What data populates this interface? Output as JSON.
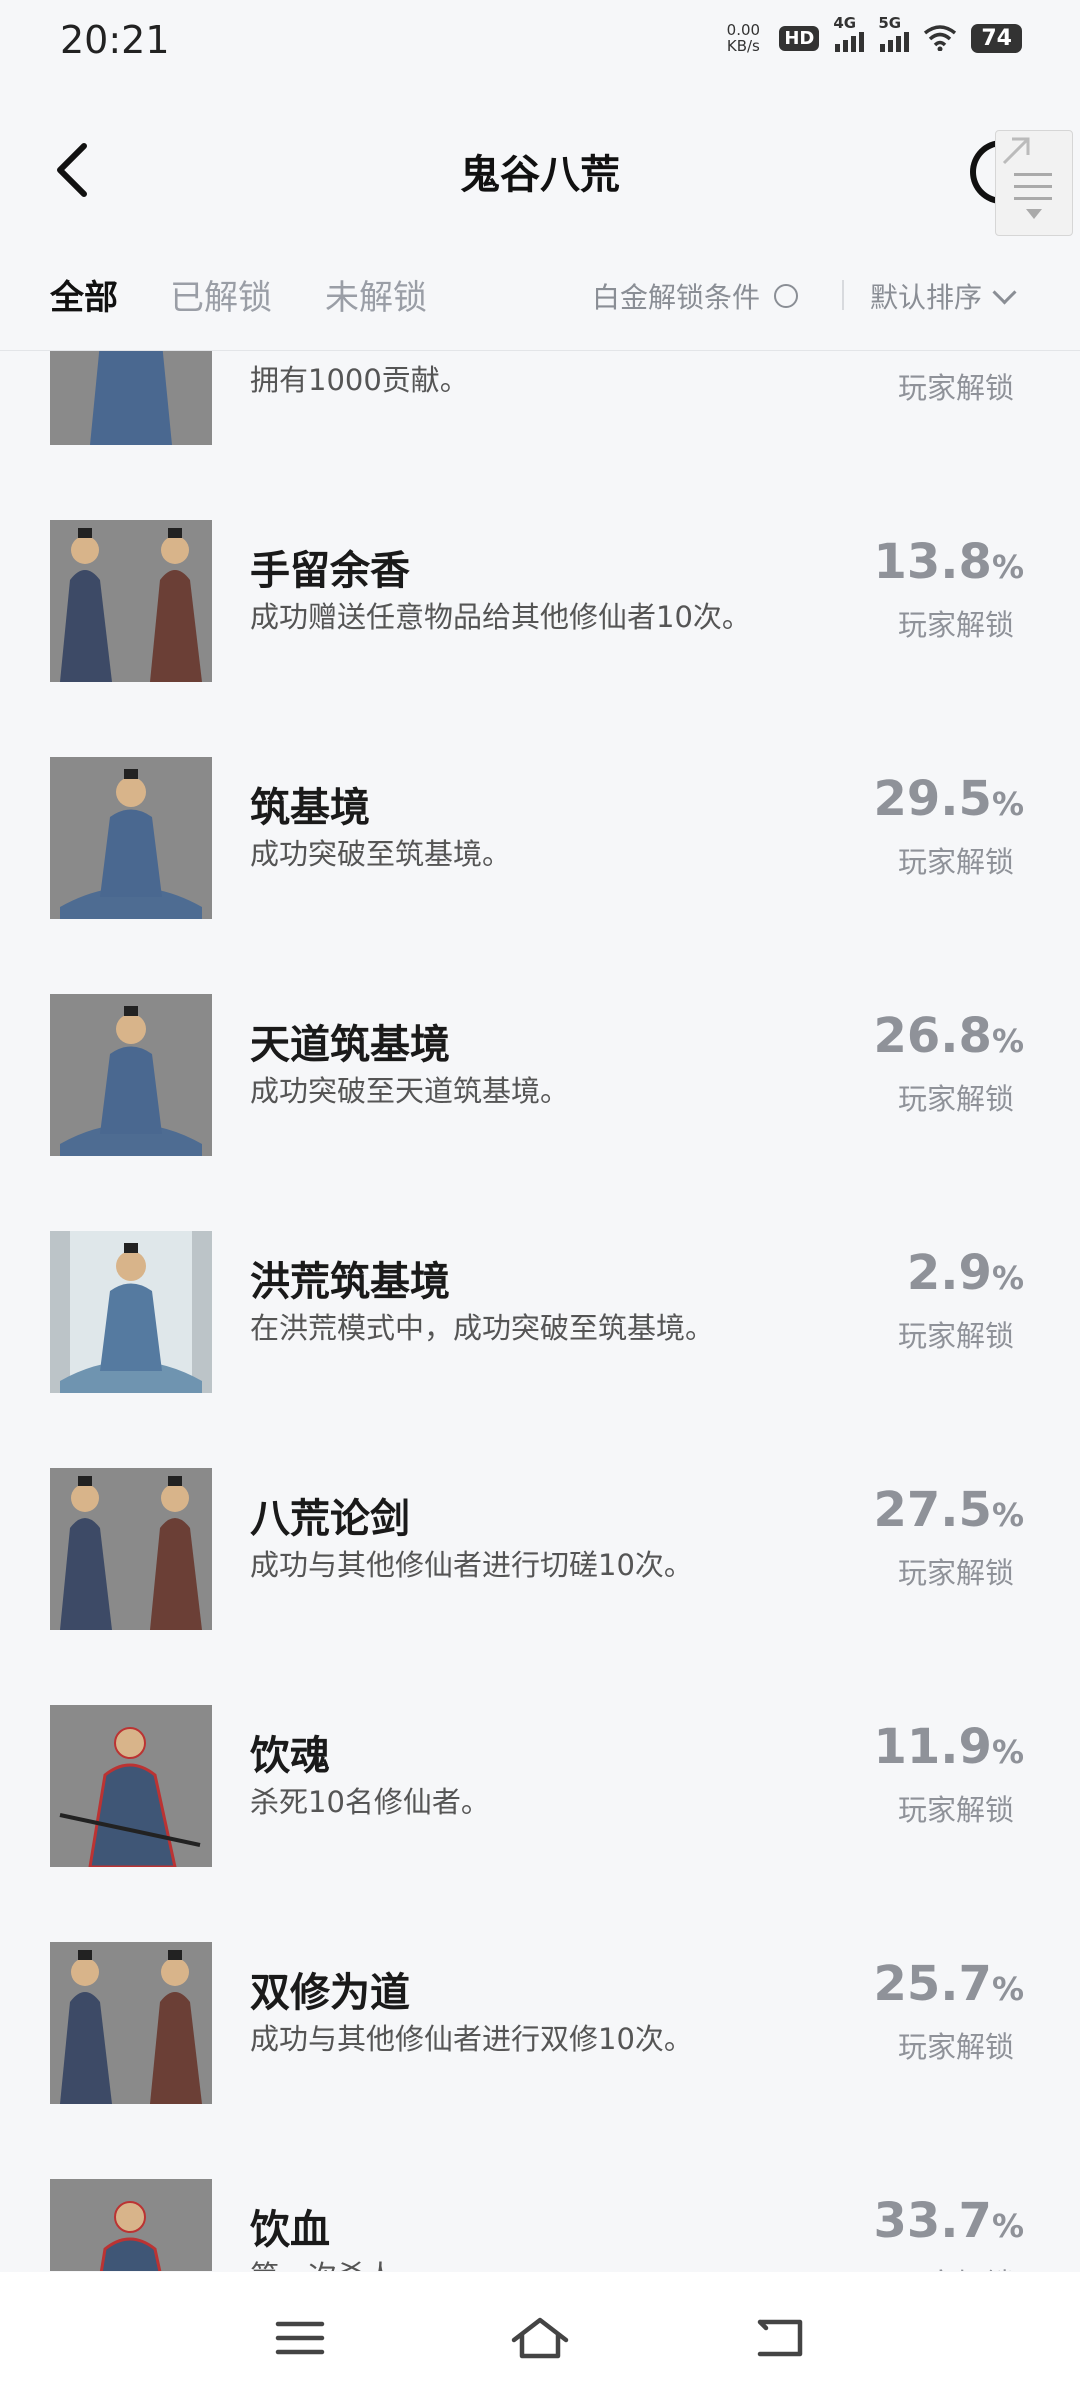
{
  "status": {
    "time": "20:21",
    "net_speed_value": "0.00",
    "net_speed_unit": "KB/s",
    "hd": "HD",
    "sim1": "4G",
    "sim2": "5G",
    "battery": "74"
  },
  "header": {
    "title": "鬼谷八荒"
  },
  "filters": {
    "tabs": [
      "全部",
      "已解锁",
      "未解锁"
    ],
    "condition_label": "白金解锁条件",
    "sort_label": "默认排序"
  },
  "unlock_suffix": "玩家解锁",
  "percent_unit": "%",
  "achievements": [
    {
      "name": "",
      "desc": "拥有1000贡献。",
      "percent": "",
      "icon": "cultivator-standing-icon"
    },
    {
      "name": "手留余香",
      "desc": "成功赠送任意物品给其他修仙者10次。",
      "percent": "13.8",
      "icon": "two-cultivators-bowing-icon"
    },
    {
      "name": "筑基境",
      "desc": "成功突破至筑基境。",
      "percent": "29.5",
      "icon": "meditating-cultivator-icon"
    },
    {
      "name": "天道筑基境",
      "desc": "成功突破至天道筑基境。",
      "percent": "26.8",
      "icon": "meditating-cultivator-icon"
    },
    {
      "name": "洪荒筑基境",
      "desc": "在洪荒模式中，成功突破至筑基境。",
      "percent": "2.9",
      "icon": "meditating-cultivator-glow-icon"
    },
    {
      "name": "八荒论剑",
      "desc": "成功与其他修仙者进行切磋10次。",
      "percent": "27.5",
      "icon": "two-cultivators-bowing-icon"
    },
    {
      "name": "饮魂",
      "desc": "杀死10名修仙者。",
      "percent": "11.9",
      "icon": "swordsman-red-aura-icon"
    },
    {
      "name": "双修为道",
      "desc": "成功与其他修仙者进行双修10次。",
      "percent": "25.7",
      "icon": "two-cultivators-bowing-icon"
    },
    {
      "name": "饮血",
      "desc": "第一次杀人。",
      "percent": "33.7",
      "icon": "swordsman-red-aura-icon"
    }
  ],
  "colors": {
    "background": "#f6f7f9",
    "percent_gray": "#8f9299",
    "title_black": "#111111"
  }
}
